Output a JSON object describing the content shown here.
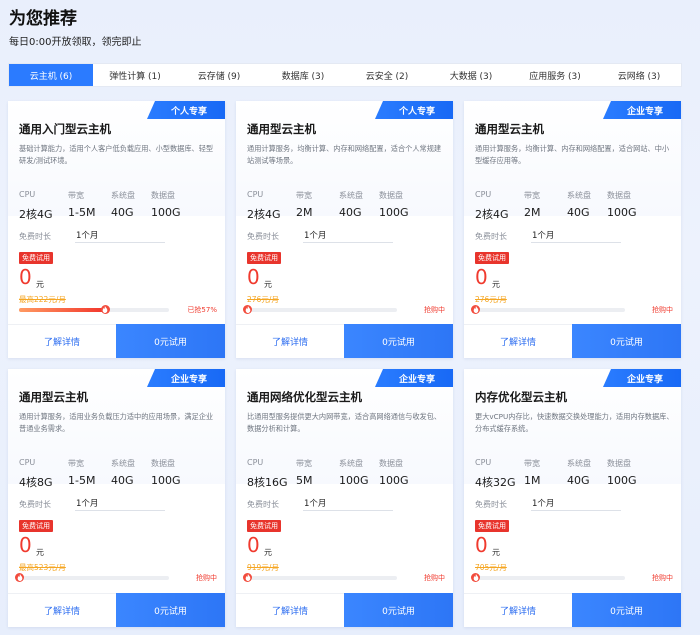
{
  "header": {
    "title": "为您推荐",
    "subtitle": "每日0:00开放领取，领完即止"
  },
  "tabs": [
    {
      "label": "云主机 (6)",
      "active": true
    },
    {
      "label": "弹性计算 (1)",
      "active": false
    },
    {
      "label": "云存储 (9)",
      "active": false
    },
    {
      "label": "数据库 (3)",
      "active": false
    },
    {
      "label": "云安全 (2)",
      "active": false
    },
    {
      "label": "大数据 (3)",
      "active": false
    },
    {
      "label": "应用服务 (3)",
      "active": false
    },
    {
      "label": "云网络 (3)",
      "active": false
    }
  ],
  "spec_labels": [
    "CPU",
    "带宽",
    "系统盘",
    "数据盘"
  ],
  "trial_label": "免费时长",
  "free_tag": "免费试用",
  "price_unit": "元",
  "detail_label": "了解详情",
  "try_label": "0元试用",
  "accent_color": "#2b7bff",
  "price_color": "#f03a2e",
  "cards": [
    {
      "badge": "个人专享",
      "title": "通用入门型云主机",
      "desc": "基础计算能力，适用个人客户低负载应用、小型数据库、轻型研发/测试环境。",
      "specs": [
        "2核4G",
        "1-5M",
        "40G",
        "100G"
      ],
      "trial": "1个月",
      "price": "0",
      "orig_price": "最高222元/月",
      "progress": 0.57,
      "status": "已抢57%"
    },
    {
      "badge": "个人专享",
      "title": "通用型云主机",
      "desc": "通用计算服务，均衡计算、内存和网络配置，适合个人常规建站测试等场景。",
      "specs": [
        "2核4G",
        "2M",
        "40G",
        "100G"
      ],
      "trial": "1个月",
      "price": "0",
      "orig_price": "276元/月",
      "progress": 0,
      "status": "抢购中"
    },
    {
      "badge": "企业专享",
      "title": "通用型云主机",
      "desc": "通用计算服务，均衡计算、内存和网络配置，适合网站、中小型缓存应用等。",
      "specs": [
        "2核4G",
        "2M",
        "40G",
        "100G"
      ],
      "trial": "1个月",
      "price": "0",
      "orig_price": "276元/月",
      "progress": 0,
      "status": "抢购中"
    },
    {
      "badge": "企业专享",
      "title": "通用型云主机",
      "desc": "通用计算服务，适用业务负载压力适中的应用场景，满足企业普通业务需求。",
      "specs": [
        "4核8G",
        "1-5M",
        "40G",
        "100G"
      ],
      "trial": "1个月",
      "price": "0",
      "orig_price": "最高523元/月",
      "progress": 0,
      "status": "抢购中"
    },
    {
      "badge": "企业专享",
      "title": "通用网络优化型云主机",
      "desc": "比通用型服务提供更大内网带宽，适合高网络通信与收发包、数据分析和计算。",
      "specs": [
        "8核16G",
        "5M",
        "100G",
        "100G"
      ],
      "trial": "1个月",
      "price": "0",
      "orig_price": "919元/月",
      "progress": 0,
      "status": "抢购中"
    },
    {
      "badge": "企业专享",
      "title": "内存优化型云主机",
      "desc": "更大vCPU内存比，快速数据交换处理能力，适用内存数据库、分布式缓存系统。",
      "specs": [
        "4核32G",
        "1M",
        "40G",
        "100G"
      ],
      "trial": "1个月",
      "price": "0",
      "orig_price": "705元/月",
      "progress": 0,
      "status": "抢购中"
    }
  ]
}
